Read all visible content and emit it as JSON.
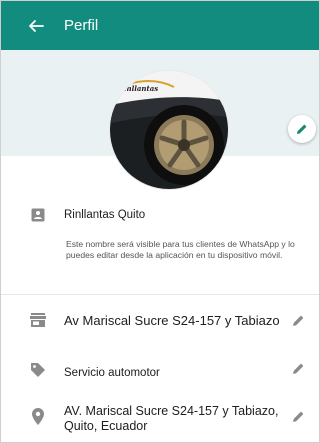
{
  "header": {
    "title": "Perfil"
  },
  "profile": {
    "logo_text": "Rinllantas",
    "name": "Rinllantas Quito",
    "name_note": "Este nombre será visible para tus clientes de WhatsApp y lo puedes editar desde la aplicación en tu dispositivo móvil."
  },
  "rows": {
    "address": "Av Mariscal Sucre S24-157 y Tabiazo",
    "category": "Servicio automotor",
    "location_line1": "AV. Mariscal Sucre S24-157 y Tabiazo,",
    "location_line2": "Quito, Ecuador"
  },
  "colors": {
    "header_bg": "#128c7e",
    "hero_bg": "#eaf1f3",
    "accent": "#1a8a6f",
    "icon_gray": "#8a8a8a"
  },
  "icons": {
    "back": "arrow-left-icon",
    "edit_fab": "pencil-icon",
    "name": "id-card-icon",
    "address": "storefront-icon",
    "category": "tag-icon",
    "location": "map-pin-icon",
    "row_edit": "pencil-icon"
  }
}
